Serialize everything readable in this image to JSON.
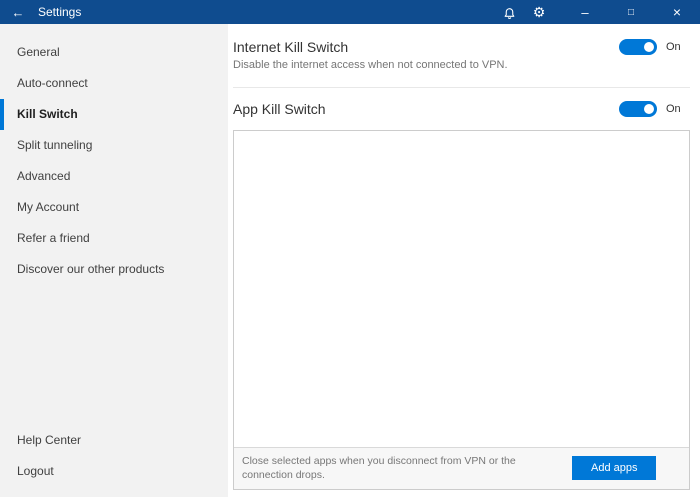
{
  "titlebar": {
    "title": "Settings",
    "icons": {
      "back": "←",
      "gear": "⚙",
      "minimize": "–",
      "maximize": "□",
      "close": "×"
    }
  },
  "sidebar": {
    "items": [
      {
        "label": "General",
        "selected": false
      },
      {
        "label": "Auto-connect",
        "selected": false
      },
      {
        "label": "Kill Switch",
        "selected": true
      },
      {
        "label": "Split tunneling",
        "selected": false
      },
      {
        "label": "Advanced",
        "selected": false
      },
      {
        "label": "My Account",
        "selected": false
      },
      {
        "label": "Refer a friend",
        "selected": false
      },
      {
        "label": "Discover our other products",
        "selected": false
      }
    ],
    "bottom_items": [
      {
        "label": "Help Center"
      },
      {
        "label": "Logout"
      }
    ]
  },
  "main": {
    "internet_kill_switch": {
      "title": "Internet Kill Switch",
      "description": "Disable the internet access when not connected to VPN.",
      "state_label": "On",
      "enabled": true
    },
    "app_kill_switch": {
      "title": "App Kill Switch",
      "state_label": "On",
      "enabled": true,
      "footer_text": "Close selected apps when you disconnect from VPN or the connection drops.",
      "add_apps_button": "Add apps"
    }
  },
  "colors": {
    "titlebar_bg": "#0f4c8f",
    "accent": "#0078d7",
    "sidebar_bg": "#f2f2f2"
  }
}
